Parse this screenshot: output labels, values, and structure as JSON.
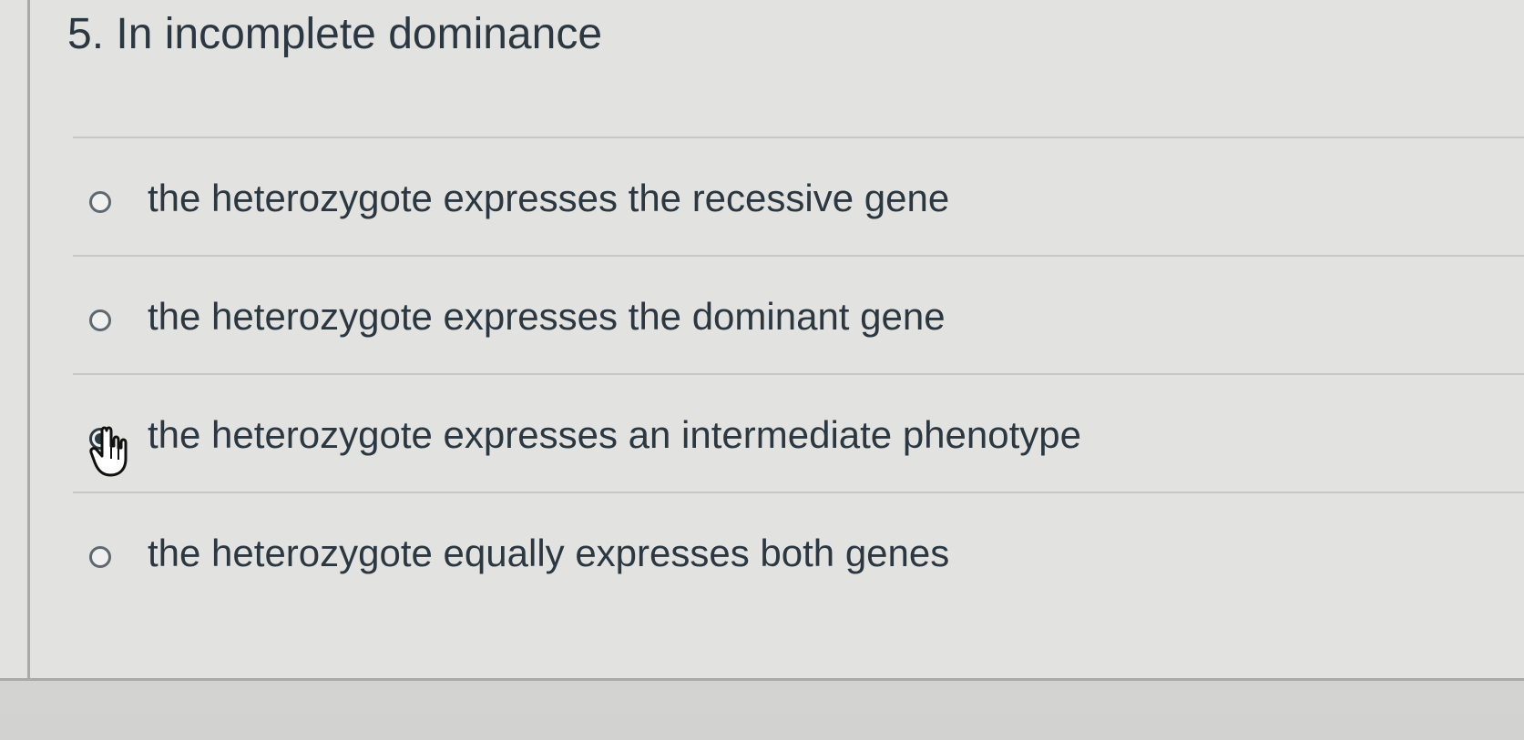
{
  "question": {
    "title": "5. In incomplete dominance"
  },
  "options": [
    {
      "label": "the heterozygote expresses the recessive gene",
      "selected": false
    },
    {
      "label": "the heterozygote expresses the dominant gene",
      "selected": false
    },
    {
      "label": "the heterozygote expresses an intermediate phenotype",
      "selected": true
    },
    {
      "label": "the heterozygote equally expresses both genes",
      "selected": false
    }
  ],
  "icons": {
    "radio": "radio-button-icon",
    "cursor": "hand-pointer-icon"
  },
  "colors": {
    "text": "#2b3741",
    "radio_border": "#5e6870",
    "selected_fill": "#2d3b45",
    "divider": "#c7c7c5"
  }
}
